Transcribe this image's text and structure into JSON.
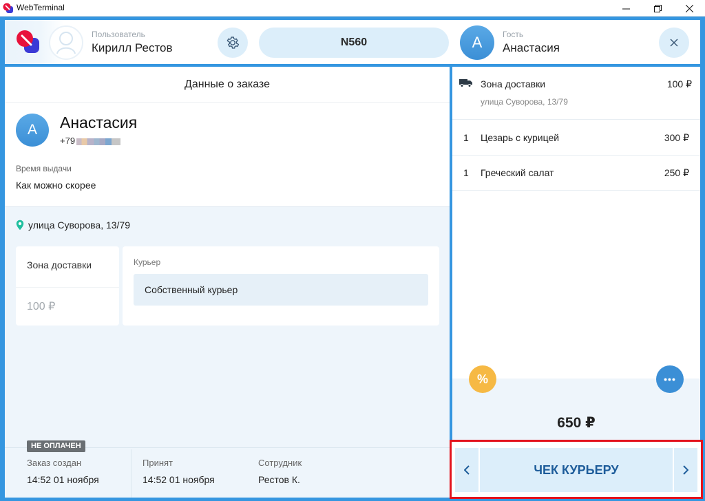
{
  "window": {
    "title": "WebTerminal"
  },
  "header": {
    "user_label": "Пользователь",
    "user_name": "Кирилл Рестов",
    "order_number": "N560",
    "guest_label": "Гость",
    "guest_initial": "А",
    "guest_name": "Анастасия"
  },
  "order": {
    "panel_title": "Данные о заказе",
    "customer_initial": "А",
    "customer_name": "Анастасия",
    "phone_prefix": "+79",
    "time_label": "Время выдачи",
    "time_value": "Как можно скорее",
    "address": "улица Суворова, 13/79",
    "zone_label": "Зона доставки",
    "zone_price": "100 ₽",
    "courier_label": "Курьер",
    "courier_value": "Собственный курьер",
    "unpaid_badge": "НЕ ОПЛАЧЕН",
    "footer": [
      {
        "label": "Заказ создан",
        "value": "14:52 01 ноября"
      },
      {
        "label": "Принят",
        "value": "14:52 01 ноября"
      },
      {
        "label": "Сотрудник",
        "value": "Рестов К."
      }
    ]
  },
  "cart": {
    "delivery": {
      "name": "Зона доставки",
      "price": "100 ₽",
      "address": "улица Суворова, 13/79"
    },
    "items": [
      {
        "qty": "1",
        "name": "Цезарь с курицей",
        "price": "300 ₽"
      },
      {
        "qty": "1",
        "name": "Греческий салат",
        "price": "250 ₽"
      }
    ],
    "discount_symbol": "%",
    "more_symbol": "•••",
    "total": "650 ₽"
  },
  "actions": {
    "check_label": "ЧЕК КУРЬЕРУ"
  },
  "colors": {
    "accent": "#3596e0",
    "highlight": "#e3141e",
    "discount": "#f6b944"
  },
  "icons": [
    "app-logo-icon",
    "minimize-icon",
    "restore-icon",
    "close-window-icon",
    "user-placeholder-icon",
    "gear-icon",
    "close-icon",
    "map-pin-icon",
    "truck-icon",
    "percent-icon",
    "more-icon",
    "chevron-left-icon",
    "chevron-right-icon"
  ]
}
